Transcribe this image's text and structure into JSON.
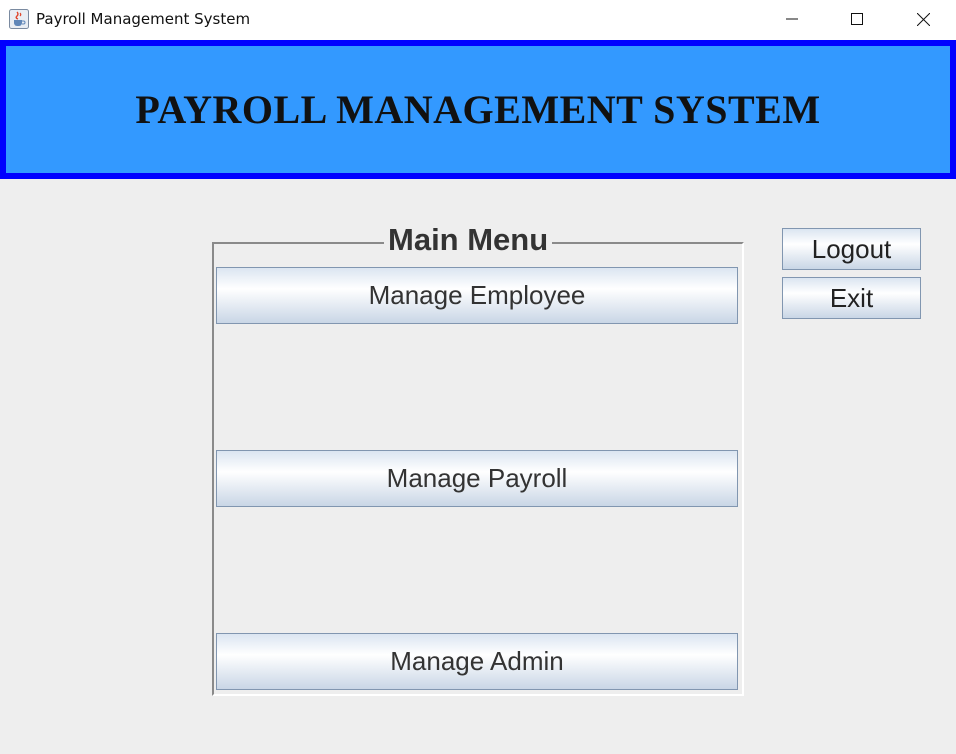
{
  "window": {
    "title": "Payroll Management System",
    "icon": "java-cup-icon"
  },
  "header": {
    "title": "PAYROLL MANAGEMENT SYSTEM",
    "background_color": "#3399ff",
    "border_color": "#0000ff"
  },
  "main_menu": {
    "title": "Main Menu",
    "buttons": [
      {
        "label": "Manage Employee"
      },
      {
        "label": "Manage Payroll"
      },
      {
        "label": "Manage Admin"
      }
    ]
  },
  "actions": {
    "logout_label": "Logout",
    "exit_label": "Exit"
  }
}
